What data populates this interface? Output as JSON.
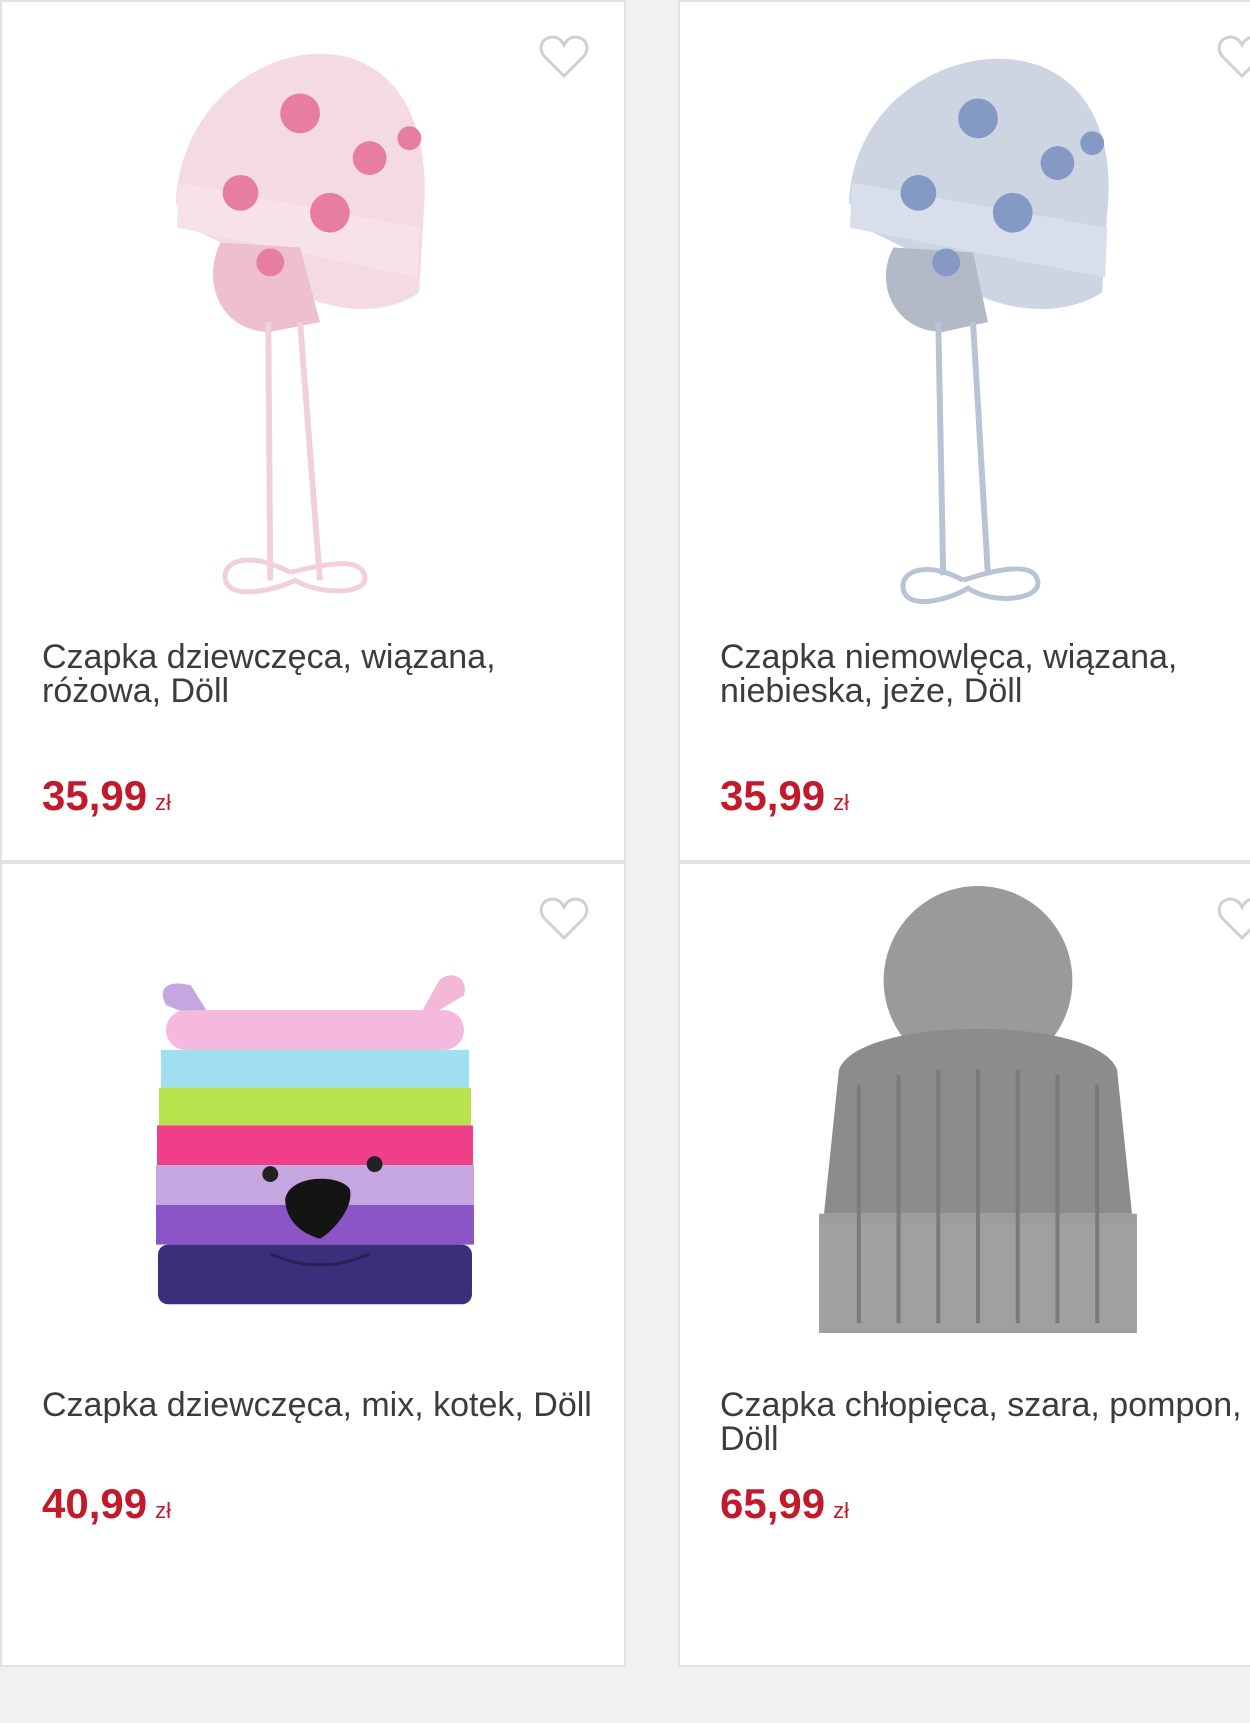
{
  "currency": "zł",
  "products": [
    {
      "title": "Czapka dziewczęca, wiązana, różowa, Döll",
      "price": "35,99"
    },
    {
      "title": "Czapka niemowlęca, wiązana, niebieska, jeże, Döll",
      "price": "35,99"
    },
    {
      "title": "Czapka dziewczęca, mix, kotek, Döll",
      "price": "40,99"
    },
    {
      "title": "Czapka chłopięca, szara, pompon, Döll",
      "price": "65,99"
    }
  ],
  "colors": {
    "price": "#c31a2b",
    "title": "#3c3c3c",
    "border": "#e2e2e2",
    "heart": "#d0d0d0"
  },
  "icons": [
    "heart-outline-icon"
  ]
}
